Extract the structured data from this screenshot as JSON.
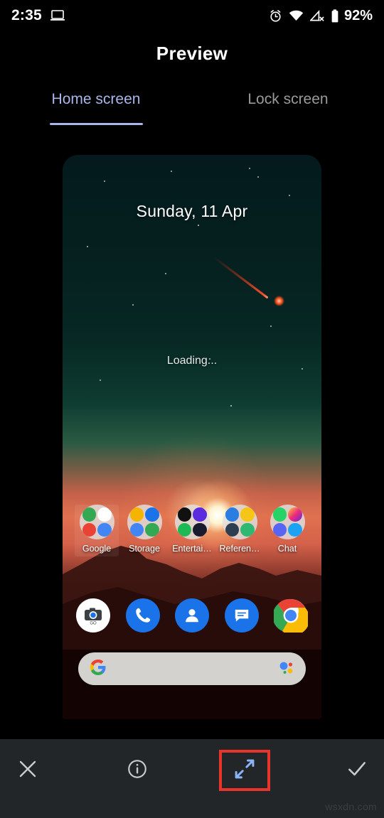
{
  "status_bar": {
    "time": "2:35",
    "cast_icon": "laptop-icon",
    "alarm_icon": "alarm-icon",
    "wifi_icon": "wifi-icon",
    "signal_icon": "signal-no-sim-icon",
    "battery_icon": "battery-icon",
    "battery_percent": "92%"
  },
  "header": {
    "title": "Preview"
  },
  "tabs": [
    {
      "label": "Home screen",
      "active": true
    },
    {
      "label": "Lock screen",
      "active": false
    }
  ],
  "preview": {
    "date_widget": "Sunday, 11 Apr",
    "loading_text": "Loading...",
    "folders": [
      {
        "label": "Google",
        "name": "folder-google"
      },
      {
        "label": "Storage",
        "name": "folder-storage"
      },
      {
        "label": "Entertai…",
        "name": "folder-entertainment"
      },
      {
        "label": "Referen…",
        "name": "folder-reference"
      },
      {
        "label": "Chat",
        "name": "folder-chat"
      }
    ],
    "dock": [
      {
        "name": "camera-go-app-icon"
      },
      {
        "name": "phone-app-icon"
      },
      {
        "name": "contacts-app-icon"
      },
      {
        "name": "messages-app-icon"
      },
      {
        "name": "chrome-app-icon"
      }
    ],
    "search_bar": {
      "google_icon": "google-g-icon",
      "assistant_icon": "google-assistant-icon",
      "placeholder": ""
    }
  },
  "toolbar": {
    "close": {
      "name": "close-button",
      "icon": "x-icon"
    },
    "info": {
      "name": "info-button",
      "icon": "info-circle-icon"
    },
    "expand": {
      "name": "expand-button",
      "icon": "expand-arrows-icon",
      "highlighted": true
    },
    "confirm": {
      "name": "confirm-button",
      "icon": "check-icon"
    }
  },
  "watermark": "wsxdn.com",
  "colors": {
    "accent_tab": "#aab6ea",
    "highlight_box": "#e8342a",
    "expand_icon": "#8ab4f8",
    "toolbar_bg": "#232629",
    "page_bg": "#000000"
  }
}
